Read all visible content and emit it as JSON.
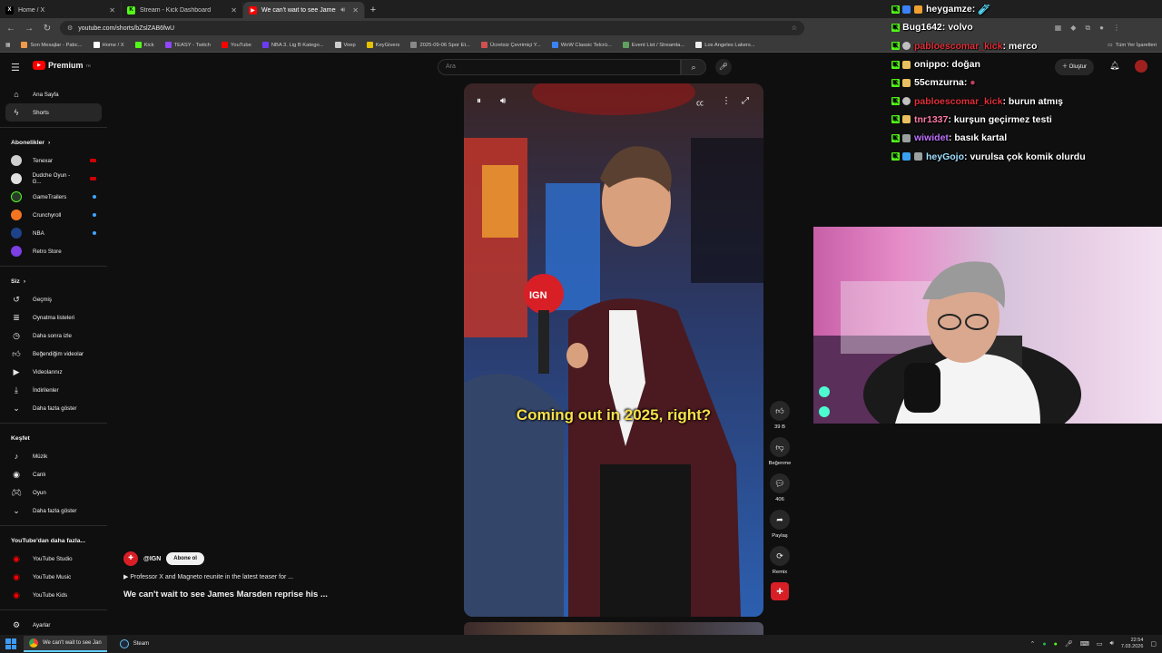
{
  "browser": {
    "tabs": [
      {
        "title": "Home / X",
        "icon": "x-logo-icon",
        "active": false
      },
      {
        "title": "Stream - Kick Dashboard",
        "icon": "kick-logo-icon",
        "active": false
      },
      {
        "title": "We can't wait to see James",
        "icon": "youtube-logo-icon",
        "active": true
      }
    ],
    "url": "youtube.com/shorts/bZslZAB6fwU",
    "bookmarks": [
      {
        "label": "Son Mesajlar - Pabc...",
        "color": "#f2994a"
      },
      {
        "label": "Home / X",
        "color": "#ffffff"
      },
      {
        "label": "Kick",
        "color": "#53fc18"
      },
      {
        "label": "TEASY - Twitch",
        "color": "#9146ff"
      },
      {
        "label": "YouTube",
        "color": "#ff0000"
      },
      {
        "label": "NBA 3. Lig B Katego...",
        "color": "#6c3cf5"
      },
      {
        "label": "Voep",
        "color": "#cccccc"
      },
      {
        "label": "KeyGivers",
        "color": "#e6c200"
      },
      {
        "label": "2025-09-06 Spor Et...",
        "color": "#888888"
      },
      {
        "label": "Ücretsiz Çevrimiçi Y...",
        "color": "#d05050"
      },
      {
        "label": "WoW Classic Telcrú...",
        "color": "#3b82f6"
      },
      {
        "label": "Event List / Streamla...",
        "color": "#60a060"
      },
      {
        "label": "Los Angeles Lakers...",
        "color": "#eeeeee"
      }
    ],
    "bookmarks_right": "Tüm Yer İşaretleri"
  },
  "youtube": {
    "logo": "Premium",
    "logo_sup": "TR",
    "search_placeholder": "Ara",
    "create_label": "Oluştur",
    "sidebar": {
      "top": [
        {
          "label": "Ana Sayfa",
          "icon": "home-icon",
          "selected": false
        },
        {
          "label": "Shorts",
          "icon": "shorts-icon",
          "selected": true
        }
      ],
      "subs_header": "Abonelikler",
      "subscriptions": [
        {
          "label": "Tenexar",
          "color": "#cfcfcf",
          "badge": "live"
        },
        {
          "label": "Dudche Oyun - G...",
          "color": "#e0e0e0",
          "badge": "live"
        },
        {
          "label": "GameTrailers",
          "color": "#2a3a2a",
          "badge": "dot"
        },
        {
          "label": "Crunchyroll",
          "color": "#f47521",
          "badge": "dot"
        },
        {
          "label": "NBA",
          "color": "#1d428a",
          "badge": "dot"
        },
        {
          "label": "Retro Store",
          "color": "#7b3fe4",
          "badge": ""
        }
      ],
      "you_header": "Siz",
      "you": [
        {
          "label": "Geçmiş",
          "icon": "history-icon"
        },
        {
          "label": "Oynatma listeleri",
          "icon": "playlist-icon"
        },
        {
          "label": "Daha sonra izle",
          "icon": "watch-later-icon"
        },
        {
          "label": "Beğendiğim videolar",
          "icon": "thumb-up-icon"
        },
        {
          "label": "Videolarınız",
          "icon": "your-videos-icon"
        },
        {
          "label": "İndirilenler",
          "icon": "download-icon"
        },
        {
          "label": "Daha fazla göster",
          "icon": "chevron-down-icon"
        }
      ],
      "explore_header": "Keşfet",
      "explore": [
        {
          "label": "Müzik",
          "icon": "music-icon"
        },
        {
          "label": "Canlı",
          "icon": "live-icon"
        },
        {
          "label": "Oyun",
          "icon": "gaming-icon"
        },
        {
          "label": "Daha fazla göster",
          "icon": "chevron-down-icon"
        }
      ],
      "more_header": "YouTube'dan daha fazla...",
      "more": [
        {
          "label": "YouTube Studio",
          "icon": "studio-icon"
        },
        {
          "label": "YouTube Music",
          "icon": "yt-music-icon"
        },
        {
          "label": "YouTube Kids",
          "icon": "yt-kids-icon"
        }
      ],
      "settings": "Ayarlar"
    },
    "video": {
      "caption": "Coming out in 2025, right?",
      "channel": "@IGN",
      "subscribe": "Abone ol",
      "teaser": "▶ Professor X and Magneto reunite in the latest teaser for ...",
      "title": "We can't wait to see James Marsden reprise his ..."
    },
    "actions": [
      {
        "icon": "like-icon",
        "glyph": "👍︎",
        "label": "39 B"
      },
      {
        "icon": "dislike-icon",
        "glyph": "👎︎",
        "label": "Beğenme"
      },
      {
        "icon": "comment-icon",
        "glyph": "💬︎",
        "label": "406"
      },
      {
        "icon": "share-icon",
        "glyph": "➦",
        "label": "Paylaş"
      },
      {
        "icon": "remix-icon",
        "glyph": "⟳",
        "label": "Remix"
      },
      {
        "icon": "channel-avatar-icon",
        "glyph": "✚",
        "label": ""
      }
    ]
  },
  "chat": [
    {
      "user": "heygamze",
      "color": "#ffffff",
      "text": ""
    },
    {
      "user": "Bug1642",
      "color": "#ffffff",
      "text": "volvo"
    },
    {
      "user": "pabloescomar_kick",
      "color": "#e0303a",
      "text": "merco"
    },
    {
      "user": "onippo",
      "color": "#ffffff",
      "text": "doğan"
    },
    {
      "user": "55cmzurna",
      "color": "#ffffff",
      "text": ""
    },
    {
      "user": "pabloescomar_kick",
      "color": "#e0303a",
      "text": "burun atmış"
    },
    {
      "user": "tnr1337",
      "color": "#ff7aa8",
      "text": "kurşun geçirmez testi"
    },
    {
      "user": "wiwidet",
      "color": "#c070ff",
      "text": "basık kartal"
    },
    {
      "user": "heyGojo",
      "color": "#9fe0ff",
      "text": "vurulsa çok komik olurdu"
    }
  ],
  "taskbar": {
    "active_task": "We can't wait to see Jan",
    "task2": "Steam",
    "time": "22:54",
    "date": "7.03.2026"
  },
  "colors": {
    "kick_green": "#53fc18",
    "youtube_red": "#ff0000",
    "caption_yellow": "#f8e04a"
  }
}
